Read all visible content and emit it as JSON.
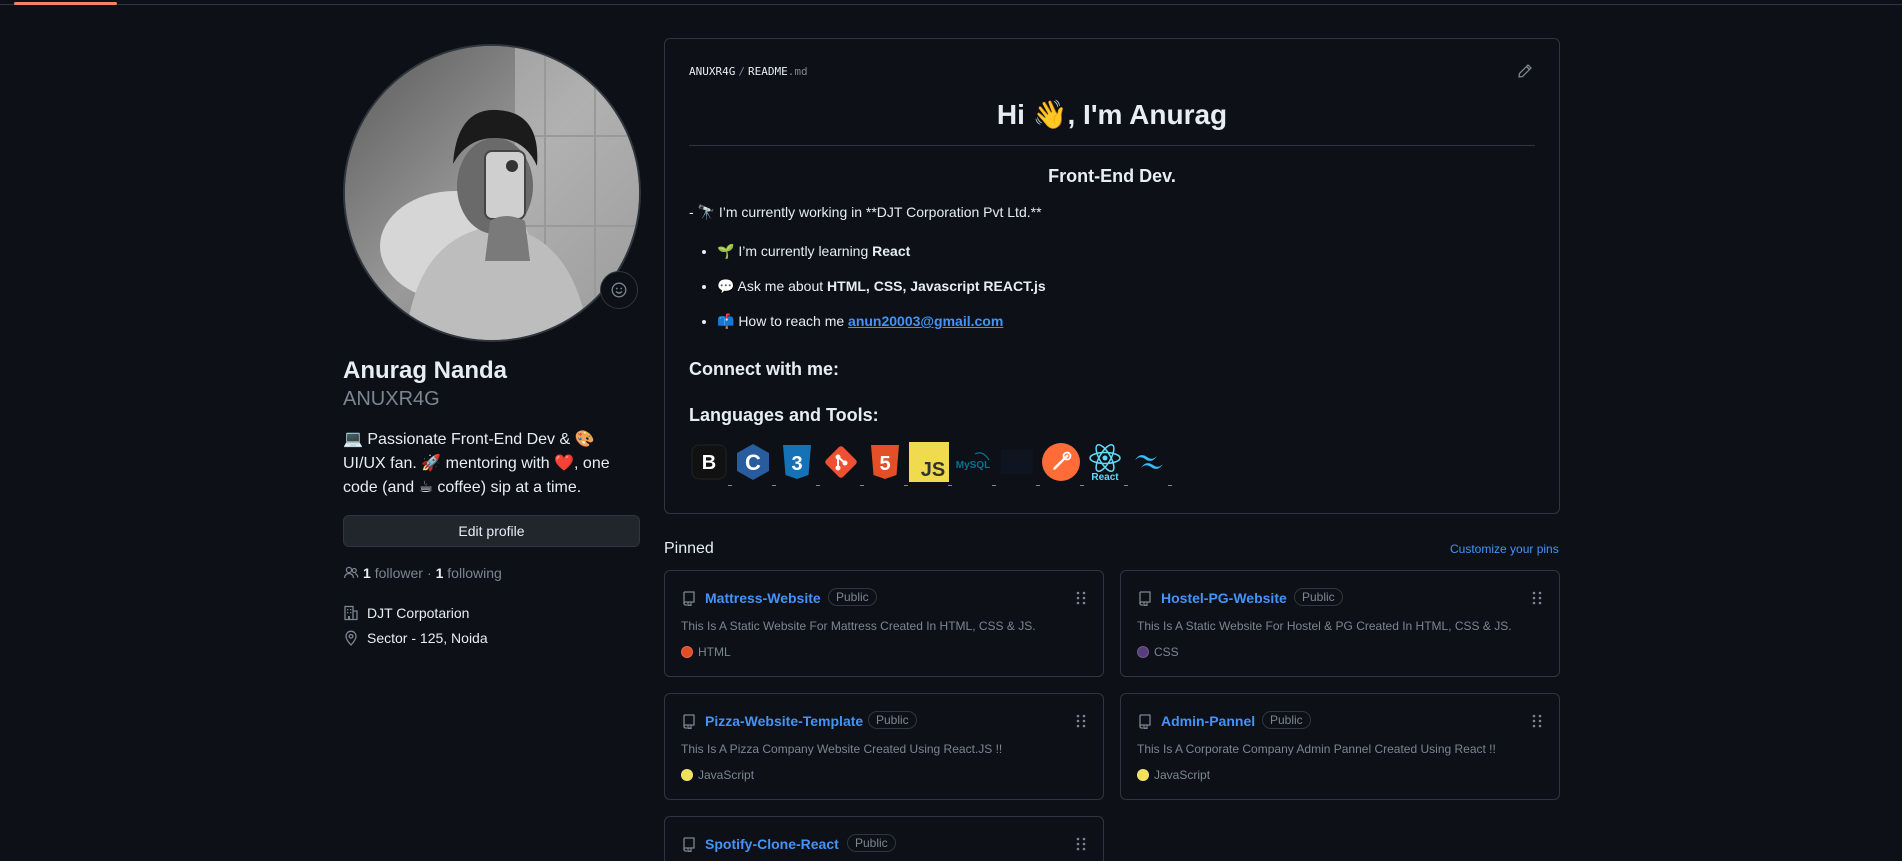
{
  "profile": {
    "full_name": "Anurag Nanda",
    "username": "ANUXR4G",
    "bio": "💻 Passionate Front-End Dev & 🎨 UI/UX fan. 🚀 mentoring with ❤️, one code (and ☕ coffee) sip at a time.",
    "edit_label": "Edit profile",
    "followers_count": "1",
    "followers_label": "follower",
    "separator": "·",
    "following_count": "1",
    "following_label": "following",
    "company": "DJT Corpotarion",
    "location": "Sector - 125, Noida"
  },
  "readme": {
    "owner": "ANUXR4G",
    "file": "README",
    "ext": ".md",
    "title": "Hi 👋, I'm Anurag",
    "subtitle": "Front-End Dev.",
    "working_line": "- 🔭 I’m currently working in **DJT Corporation Pvt Ltd.**",
    "items": [
      {
        "prefix": "🌱 I’m currently learning ",
        "bold": "React"
      },
      {
        "prefix": "💬 Ask me about ",
        "bold": "HTML, CSS, Javascript REACT.js"
      },
      {
        "prefix": "📫 How to reach me ",
        "link": "anun20003@gmail.com"
      }
    ],
    "connect_heading": "Connect with me:",
    "languages_heading": "Languages and Tools:",
    "tools": [
      {
        "name": "bootstrap",
        "glyph": "B"
      },
      {
        "name": "c",
        "glyph": "C"
      },
      {
        "name": "css3",
        "glyph": "3"
      },
      {
        "name": "git",
        "glyph": "◆"
      },
      {
        "name": "html5",
        "glyph": "5"
      },
      {
        "name": "javascript",
        "glyph": "JS"
      },
      {
        "name": "mysql",
        "glyph": "MySQL"
      },
      {
        "name": "nodejs",
        "glyph": ""
      },
      {
        "name": "postman",
        "glyph": ""
      },
      {
        "name": "react",
        "glyph": "React"
      },
      {
        "name": "tailwind",
        "glyph": "~"
      }
    ]
  },
  "pinned": {
    "title": "Pinned",
    "customize": "Customize your pins",
    "repos": [
      {
        "name": "Mattress-Website",
        "visibility": "Public",
        "description": "This Is A Static Website For Mattress Created In HTML, CSS & JS.",
        "language": "HTML",
        "color": "#e34c26"
      },
      {
        "name": "Hostel-PG-Website",
        "visibility": "Public",
        "description": "This Is A Static Website For Hostel & PG Created In HTML, CSS & JS.",
        "language": "CSS",
        "color": "#563d7c"
      },
      {
        "name": "Pizza-Website-Template",
        "visibility": "Public",
        "description": "This Is A Pizza Company Website Created Using React.JS !!",
        "language": "JavaScript",
        "color": "#f1e05a"
      },
      {
        "name": "Admin-Pannel",
        "visibility": "Public",
        "description": "This Is A Corporate Company Admin Pannel Created Using React !!",
        "language": "JavaScript",
        "color": "#f1e05a"
      },
      {
        "name": "Spotify-Clone-React",
        "visibility": "Public"
      }
    ]
  },
  "colors": {
    "accent": "#4493f8",
    "background": "#0d1117",
    "border": "#30363d",
    "tab_underline": "#f78166"
  }
}
